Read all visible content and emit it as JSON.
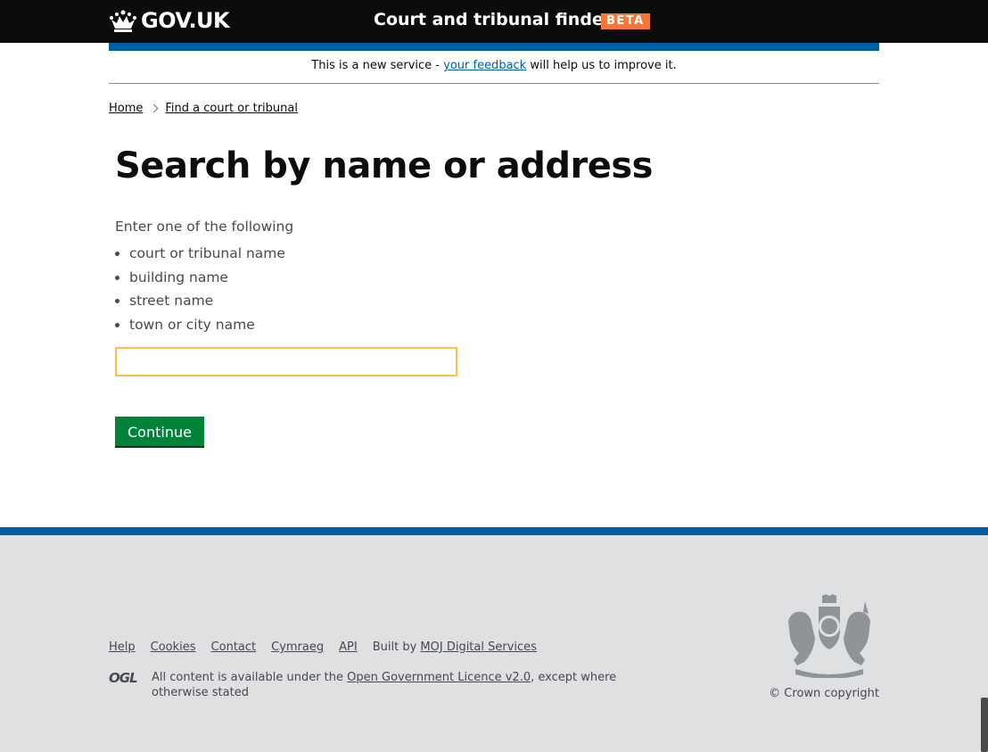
{
  "header": {
    "logo_text": "GOV.UK",
    "service_name": "Court and tribunal finder",
    "phase_tag": "BETA"
  },
  "phase_banner": {
    "text_before": "This is a new service - ",
    "link": "your feedback",
    "text_after": " will help us to improve it."
  },
  "breadcrumbs": {
    "home": "Home",
    "current": "Find a court or tribunal"
  },
  "main": {
    "title": "Search by name or address",
    "intro": "Enter one of the following",
    "options": [
      "court or tribunal name",
      "building name",
      "street name",
      "town or city name"
    ],
    "search_value": "",
    "continue_label": "Continue"
  },
  "footer": {
    "links": [
      "Help",
      "Cookies",
      "Contact",
      "Cymraeg",
      "API"
    ],
    "built_by_text": "Built by ",
    "built_by_link": "MOJ Digital Services",
    "ogl_logo": "OGL",
    "licence_before": "All content is available under the ",
    "licence_link": "Open Government Licence v2.0",
    "licence_after": ", except where otherwise stated",
    "copyright": "© Crown copyright"
  },
  "colors": {
    "header_bg": "#0b0c0c",
    "brand_blue": "#005ea5",
    "beta_orange": "#f47738",
    "button_green": "#00823b",
    "focus_yellow": "#ffbf47",
    "footer_bg": "#dee0e2"
  },
  "icons": {
    "logo": "crown-icon",
    "crest": "royal-coat-of-arms-icon"
  }
}
